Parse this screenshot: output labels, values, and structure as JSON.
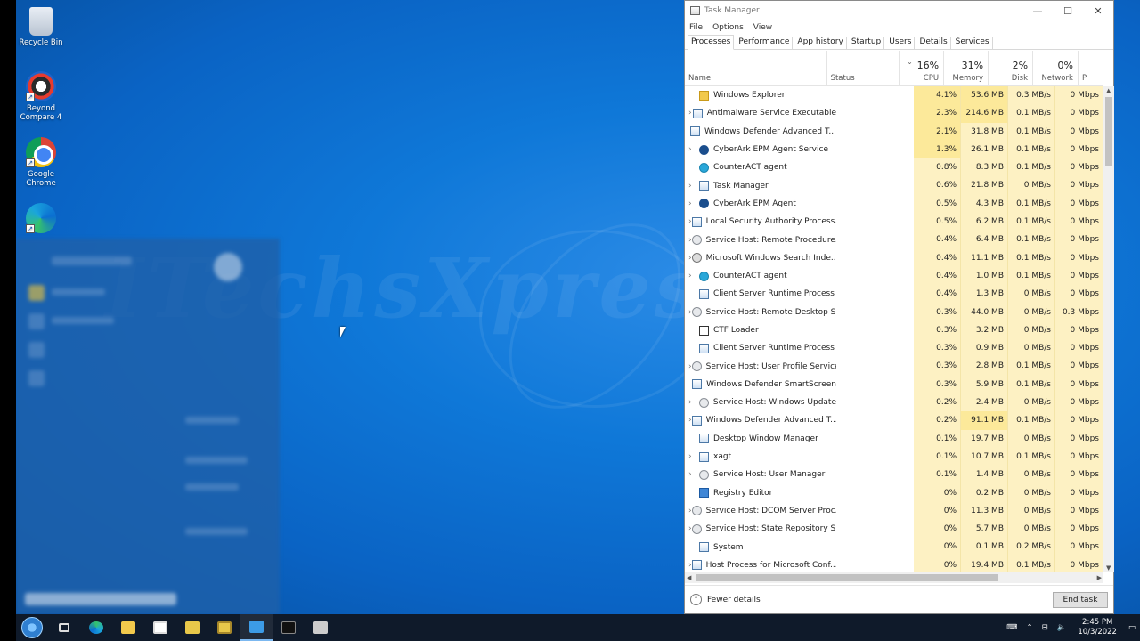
{
  "desktop": {
    "icons": [
      {
        "label": "Recycle Bin"
      },
      {
        "label": "Beyond Compare 4"
      },
      {
        "label": "Google Chrome"
      },
      {
        "label": "Microsoft Edge"
      }
    ]
  },
  "taskmanager": {
    "title": "Task Manager",
    "menu": [
      "File",
      "Options",
      "View"
    ],
    "tabs": [
      "Processes",
      "Performance",
      "App history",
      "Startup",
      "Users",
      "Details",
      "Services"
    ],
    "columns": {
      "name": "Name",
      "status": "Status",
      "cpu_pct": "16%",
      "cpu": "CPU",
      "mem_pct": "31%",
      "mem": "Memory",
      "disk_pct": "2%",
      "disk": "Disk",
      "net_pct": "0%",
      "net": "Network",
      "extra": "P"
    },
    "processes": [
      {
        "exp": "",
        "icon": "folder",
        "name": "Windows Explorer",
        "cpu": "4.1%",
        "mem": "53.6 MB",
        "disk": "0.3 MB/s",
        "net": "0 Mbps"
      },
      {
        "exp": "›",
        "icon": "app",
        "name": "Antimalware Service Executable",
        "cpu": "2.3%",
        "mem": "214.6 MB",
        "disk": "0.1 MB/s",
        "net": "0 Mbps"
      },
      {
        "exp": "",
        "icon": "app",
        "name": "Windows Defender Advanced T...",
        "cpu": "2.1%",
        "mem": "31.8 MB",
        "disk": "0.1 MB/s",
        "net": "0 Mbps"
      },
      {
        "exp": "›",
        "icon": "cyber",
        "name": "CyberArk EPM Agent Service",
        "cpu": "1.3%",
        "mem": "26.1 MB",
        "disk": "0.1 MB/s",
        "net": "0 Mbps"
      },
      {
        "exp": "",
        "icon": "counter",
        "name": "CounterACT agent",
        "cpu": "0.8%",
        "mem": "8.3 MB",
        "disk": "0.1 MB/s",
        "net": "0 Mbps"
      },
      {
        "exp": "›",
        "icon": "app",
        "name": "Task Manager",
        "cpu": "0.6%",
        "mem": "21.8 MB",
        "disk": "0 MB/s",
        "net": "0 Mbps"
      },
      {
        "exp": "›",
        "icon": "cyber",
        "name": "CyberArk EPM Agent",
        "cpu": "0.5%",
        "mem": "4.3 MB",
        "disk": "0.1 MB/s",
        "net": "0 Mbps"
      },
      {
        "exp": "›",
        "icon": "app",
        "name": "Local Security Authority Process...",
        "cpu": "0.5%",
        "mem": "6.2 MB",
        "disk": "0.1 MB/s",
        "net": "0 Mbps"
      },
      {
        "exp": "›",
        "icon": "gear",
        "name": "Service Host: Remote Procedure...",
        "cpu": "0.4%",
        "mem": "6.4 MB",
        "disk": "0.1 MB/s",
        "net": "0 Mbps"
      },
      {
        "exp": "›",
        "icon": "search",
        "name": "Microsoft Windows Search Inde...",
        "cpu": "0.4%",
        "mem": "11.1 MB",
        "disk": "0.1 MB/s",
        "net": "0 Mbps"
      },
      {
        "exp": "›",
        "icon": "counter",
        "name": "CounterACT agent",
        "cpu": "0.4%",
        "mem": "1.0 MB",
        "disk": "0.1 MB/s",
        "net": "0 Mbps"
      },
      {
        "exp": "",
        "icon": "app",
        "name": "Client Server Runtime Process",
        "cpu": "0.4%",
        "mem": "1.3 MB",
        "disk": "0 MB/s",
        "net": "0 Mbps"
      },
      {
        "exp": "›",
        "icon": "gear",
        "name": "Service Host: Remote Desktop S...",
        "cpu": "0.3%",
        "mem": "44.0 MB",
        "disk": "0 MB/s",
        "net": "0.3 Mbps"
      },
      {
        "exp": "",
        "icon": "ctf",
        "name": "CTF Loader",
        "cpu": "0.3%",
        "mem": "3.2 MB",
        "disk": "0 MB/s",
        "net": "0 Mbps"
      },
      {
        "exp": "",
        "icon": "app",
        "name": "Client Server Runtime Process",
        "cpu": "0.3%",
        "mem": "0.9 MB",
        "disk": "0 MB/s",
        "net": "0 Mbps"
      },
      {
        "exp": "›",
        "icon": "gear",
        "name": "Service Host: User Profile Service",
        "cpu": "0.3%",
        "mem": "2.8 MB",
        "disk": "0.1 MB/s",
        "net": "0 Mbps"
      },
      {
        "exp": "",
        "icon": "app",
        "name": "Windows Defender SmartScreen",
        "cpu": "0.3%",
        "mem": "5.9 MB",
        "disk": "0.1 MB/s",
        "net": "0 Mbps"
      },
      {
        "exp": "›",
        "icon": "gear",
        "name": "Service Host: Windows Update",
        "cpu": "0.2%",
        "mem": "2.4 MB",
        "disk": "0 MB/s",
        "net": "0 Mbps"
      },
      {
        "exp": "›",
        "icon": "app",
        "name": "Windows Defender Advanced T...",
        "cpu": "0.2%",
        "mem": "91.1 MB",
        "disk": "0.1 MB/s",
        "net": "0 Mbps"
      },
      {
        "exp": "",
        "icon": "app",
        "name": "Desktop Window Manager",
        "cpu": "0.1%",
        "mem": "19.7 MB",
        "disk": "0 MB/s",
        "net": "0 Mbps"
      },
      {
        "exp": "›",
        "icon": "app",
        "name": "xagt",
        "cpu": "0.1%",
        "mem": "10.7 MB",
        "disk": "0.1 MB/s",
        "net": "0 Mbps"
      },
      {
        "exp": "›",
        "icon": "gear",
        "name": "Service Host: User Manager",
        "cpu": "0.1%",
        "mem": "1.4 MB",
        "disk": "0 MB/s",
        "net": "0 Mbps"
      },
      {
        "exp": "",
        "icon": "reg",
        "name": "Registry Editor",
        "cpu": "0%",
        "mem": "0.2 MB",
        "disk": "0 MB/s",
        "net": "0 Mbps"
      },
      {
        "exp": "›",
        "icon": "gear",
        "name": "Service Host: DCOM Server Proc...",
        "cpu": "0%",
        "mem": "11.3 MB",
        "disk": "0 MB/s",
        "net": "0 Mbps"
      },
      {
        "exp": "›",
        "icon": "gear",
        "name": "Service Host: State Repository S...",
        "cpu": "0%",
        "mem": "5.7 MB",
        "disk": "0 MB/s",
        "net": "0 Mbps"
      },
      {
        "exp": "",
        "icon": "app",
        "name": "System",
        "cpu": "0%",
        "mem": "0.1 MB",
        "disk": "0.2 MB/s",
        "net": "0 Mbps"
      },
      {
        "exp": "›",
        "icon": "app",
        "name": "Host Process for Microsoft Conf...",
        "cpu": "0%",
        "mem": "19.4 MB",
        "disk": "0.1 MB/s",
        "net": "0 Mbps"
      }
    ],
    "footer": {
      "fewer": "Fewer details",
      "end_task": "End task"
    }
  },
  "taskbar": {
    "time": "2:45 PM",
    "date": "10/3/2022"
  }
}
